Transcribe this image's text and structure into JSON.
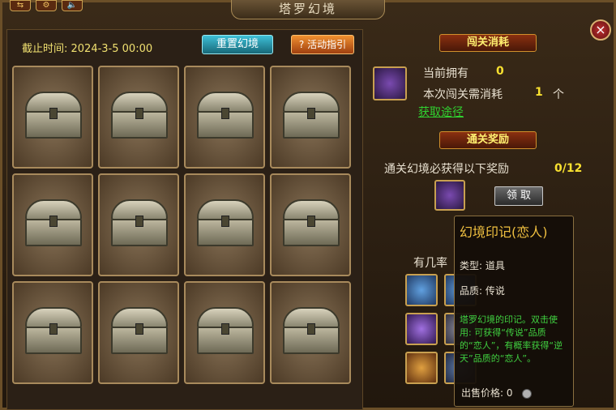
{
  "window": {
    "title": "塔罗幻境",
    "close_label": "×"
  },
  "top_icons": [
    "⇆",
    "⚙",
    "🔈"
  ],
  "left": {
    "deadline": "截止时间: 2024-3-5 00:00",
    "reset_button": "重置幻境",
    "guide_button": "? 活动指引",
    "chest_count": 12
  },
  "cost": {
    "title": "闯关消耗",
    "owned_label": "当前拥有",
    "owned_value": "0",
    "need_label": "本次闯关需消耗",
    "need_value": "1",
    "need_unit": "个",
    "obtain_link": "获取途径"
  },
  "reward": {
    "title": "通关奖励",
    "text": "通关幻境必获得以下奖励",
    "progress": "0/12",
    "claim_button": "领 取"
  },
  "drops": {
    "title_partial": "有几率"
  },
  "tooltip": {
    "name": "幻境印记(恋人)",
    "type": "类型: 道具",
    "quality": "品质: 传说",
    "description": "塔罗幻境的印记。双击使用: 可获得“传说”品质的“恋人”，有概率获得“逆天”品质的“恋人”。",
    "price_label": "出售价格:",
    "price_value": "0"
  }
}
